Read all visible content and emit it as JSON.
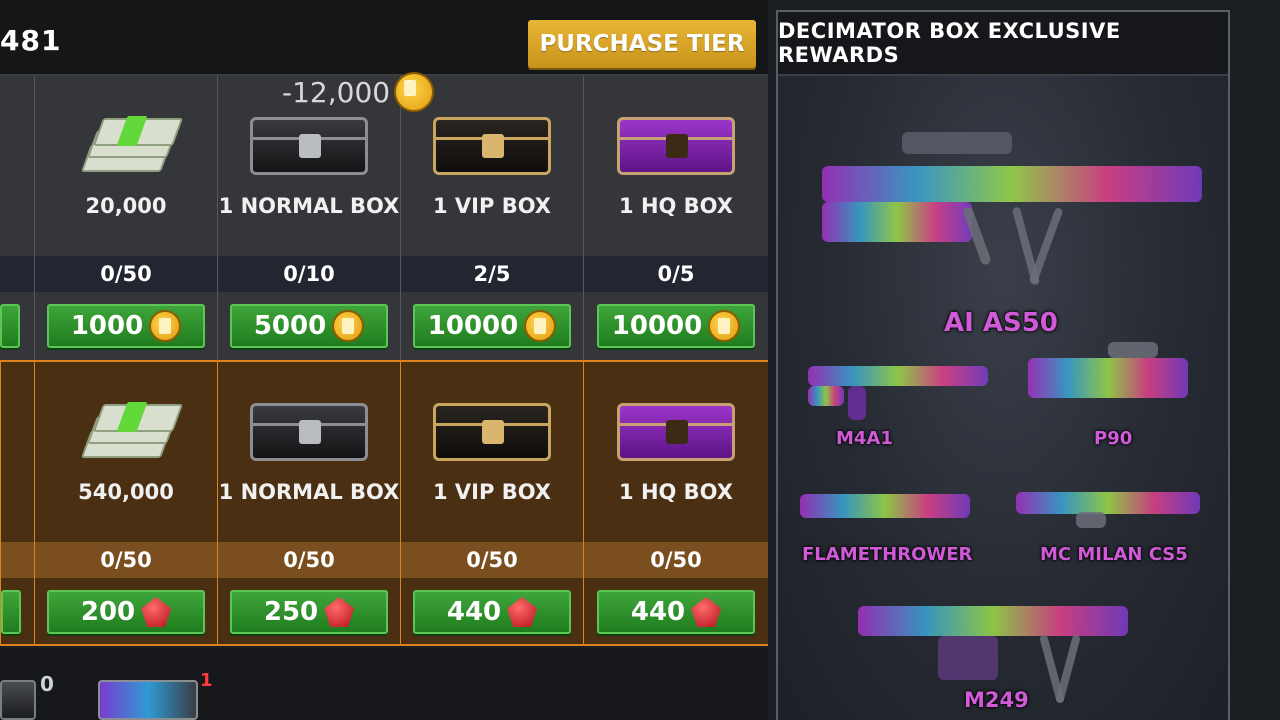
{
  "header": {
    "currency_value": "481",
    "purchase_tier_label": "PURCHASE TIER",
    "spend_note": "-12,000"
  },
  "free_row": {
    "items": [
      {
        "label": "20,000",
        "progress": "0/50",
        "price": "1000",
        "currency": "beer-icon"
      },
      {
        "label": "1 NORMAL BOX",
        "progress": "0/10",
        "price": "5000",
        "currency": "beer-icon"
      },
      {
        "label": "1 VIP BOX",
        "progress": "2/5",
        "price": "10000",
        "currency": "beer-icon"
      },
      {
        "label": "1 HQ BOX",
        "progress": "0/5",
        "price": "10000",
        "currency": "beer-icon"
      }
    ]
  },
  "premium_row": {
    "items": [
      {
        "label": "540,000",
        "progress": "0/50",
        "price": "200",
        "currency": "gem-icon"
      },
      {
        "label": "1 NORMAL BOX",
        "progress": "0/50",
        "price": "250",
        "currency": "gem-icon"
      },
      {
        "label": "1 VIP BOX",
        "progress": "0/50",
        "price": "440",
        "currency": "gem-icon"
      },
      {
        "label": "1 HQ BOX",
        "progress": "0/50",
        "price": "440",
        "currency": "gem-icon"
      }
    ]
  },
  "panel": {
    "title": "DECIMATOR BOX EXCLUSIVE REWARDS",
    "weapons": [
      "AI AS50",
      "M4A1",
      "P90",
      "FLAMETHROWER",
      "MC MILAN CS5",
      "M249"
    ]
  },
  "bottom": {
    "counts": [
      "0",
      "1"
    ]
  },
  "colors": {
    "accent_gold": "#e8b636",
    "price_green": "#2f9a2c",
    "premium_row": "#4a2f12",
    "weapon_label": "#d05ad8"
  }
}
